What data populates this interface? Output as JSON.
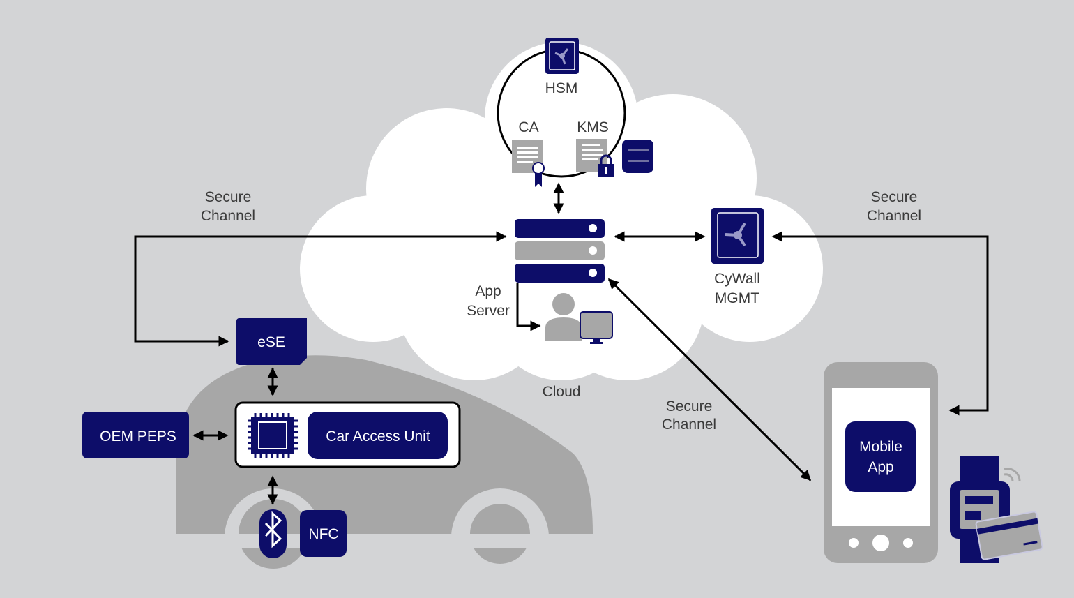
{
  "colors": {
    "background": "#d3d4d6",
    "navy": "#0d0d69",
    "gray": "#a7a7a7",
    "cloud": "#ffffff",
    "line": "#000000"
  },
  "cloud": {
    "label": "Cloud",
    "hsm": {
      "label": "HSM",
      "icon": "vault-icon"
    },
    "ca": {
      "label": "CA",
      "icon": "certificate-icon"
    },
    "kms": {
      "label": "KMS",
      "icon": "locked-document-icon"
    },
    "database_icon": "database-icon",
    "app_server": {
      "line1": "App",
      "line2": "Server",
      "icon": "server-rack-icon"
    },
    "operator_icon": "user-with-monitor-icon",
    "cywall": {
      "line1": "CyWall",
      "line2": "MGMT",
      "icon": "vault-icon"
    }
  },
  "channels": {
    "left": {
      "line1": "Secure",
      "line2": "Channel"
    },
    "right": {
      "line1": "Secure",
      "line2": "Channel"
    },
    "diagonal": {
      "line1": "Secure",
      "line2": "Channel"
    }
  },
  "car": {
    "ese": "eSE",
    "oem_peps": "OEM PEPS",
    "car_access_unit": "Car Access Unit",
    "chip_icon": "chip-icon",
    "bluetooth_icon": "bluetooth-icon",
    "nfc": "NFC"
  },
  "mobile": {
    "app_line1": "Mobile",
    "app_line2": "App",
    "phone_icon": "smartphone-icon",
    "watch_icon": "smartwatch-icon",
    "card_icon": "key-card-icon"
  }
}
